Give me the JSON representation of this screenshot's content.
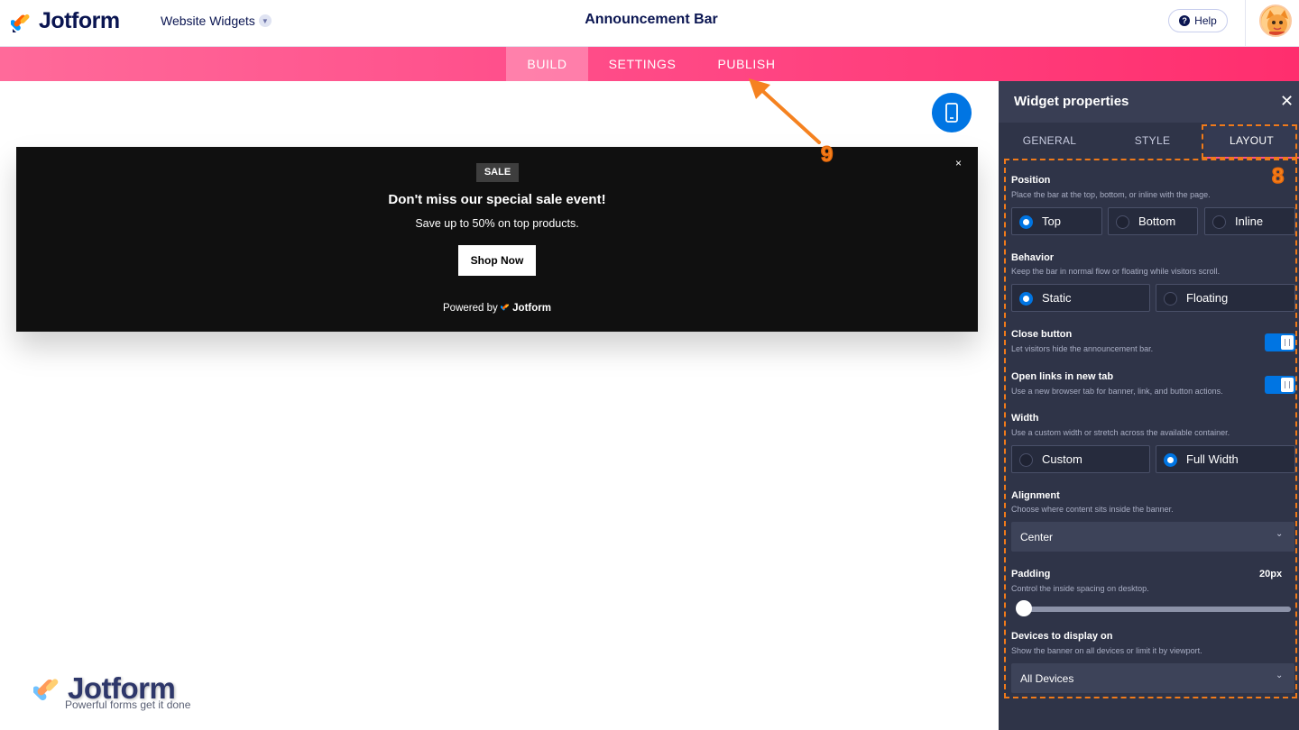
{
  "header": {
    "logo_text": "Jotform",
    "product": "Website Widgets",
    "title": "Announcement Bar",
    "help": "Help"
  },
  "nav": {
    "tabs": [
      {
        "label": "BUILD",
        "active": true
      },
      {
        "label": "SETTINGS",
        "active": false
      },
      {
        "label": "PUBLISH",
        "active": false
      }
    ]
  },
  "banner": {
    "badge": "SALE",
    "title": "Don't miss our special sale event!",
    "subtitle": "Save up to 50% on top products.",
    "cta": "Shop Now",
    "close": "×",
    "powered_by": "Powered by",
    "powered_brand": "Jotform"
  },
  "watermark": {
    "logo_text": "Jotform",
    "tagline": "Powerful forms get it done"
  },
  "panel": {
    "title": "Widget properties",
    "close": "✕",
    "tabs": [
      {
        "label": "GENERAL",
        "active": false
      },
      {
        "label": "STYLE",
        "active": false
      },
      {
        "label": "LAYOUT",
        "active": true
      }
    ],
    "position": {
      "label": "Position",
      "desc": "Place the bar at the top, bottom, or inline with the page.",
      "options": [
        "Top",
        "Bottom",
        "Inline"
      ],
      "selected": "Top"
    },
    "behavior": {
      "label": "Behavior",
      "desc": "Keep the bar in normal flow or floating while visitors scroll.",
      "options": [
        "Static",
        "Floating"
      ],
      "selected": "Static"
    },
    "close_button": {
      "label": "Close button",
      "desc": "Let visitors hide the announcement bar.",
      "on": true
    },
    "open_links": {
      "label": "Open links in new tab",
      "desc": "Use a new browser tab for banner, link, and button actions.",
      "on": true
    },
    "width": {
      "label": "Width",
      "desc": "Use a custom width or stretch across the available container.",
      "options": [
        "Custom",
        "Full Width"
      ],
      "selected": "Full Width"
    },
    "alignment": {
      "label": "Alignment",
      "desc": "Choose where content sits inside the banner.",
      "value": "Center"
    },
    "padding": {
      "label": "Padding",
      "desc": "Control the inside spacing on desktop.",
      "value": "20px"
    },
    "devices": {
      "label": "Devices to display on",
      "desc": "Show the banner on all devices or limit it by viewport.",
      "value": "All Devices"
    }
  },
  "annotations": {
    "layout_marker": "8",
    "publish_marker": "9"
  },
  "colors": {
    "accent_blue": "#0075e3",
    "nav_pink": "#ff4f8b",
    "panel_bg": "#2f3448",
    "annotation_orange": "#f07a1a"
  }
}
